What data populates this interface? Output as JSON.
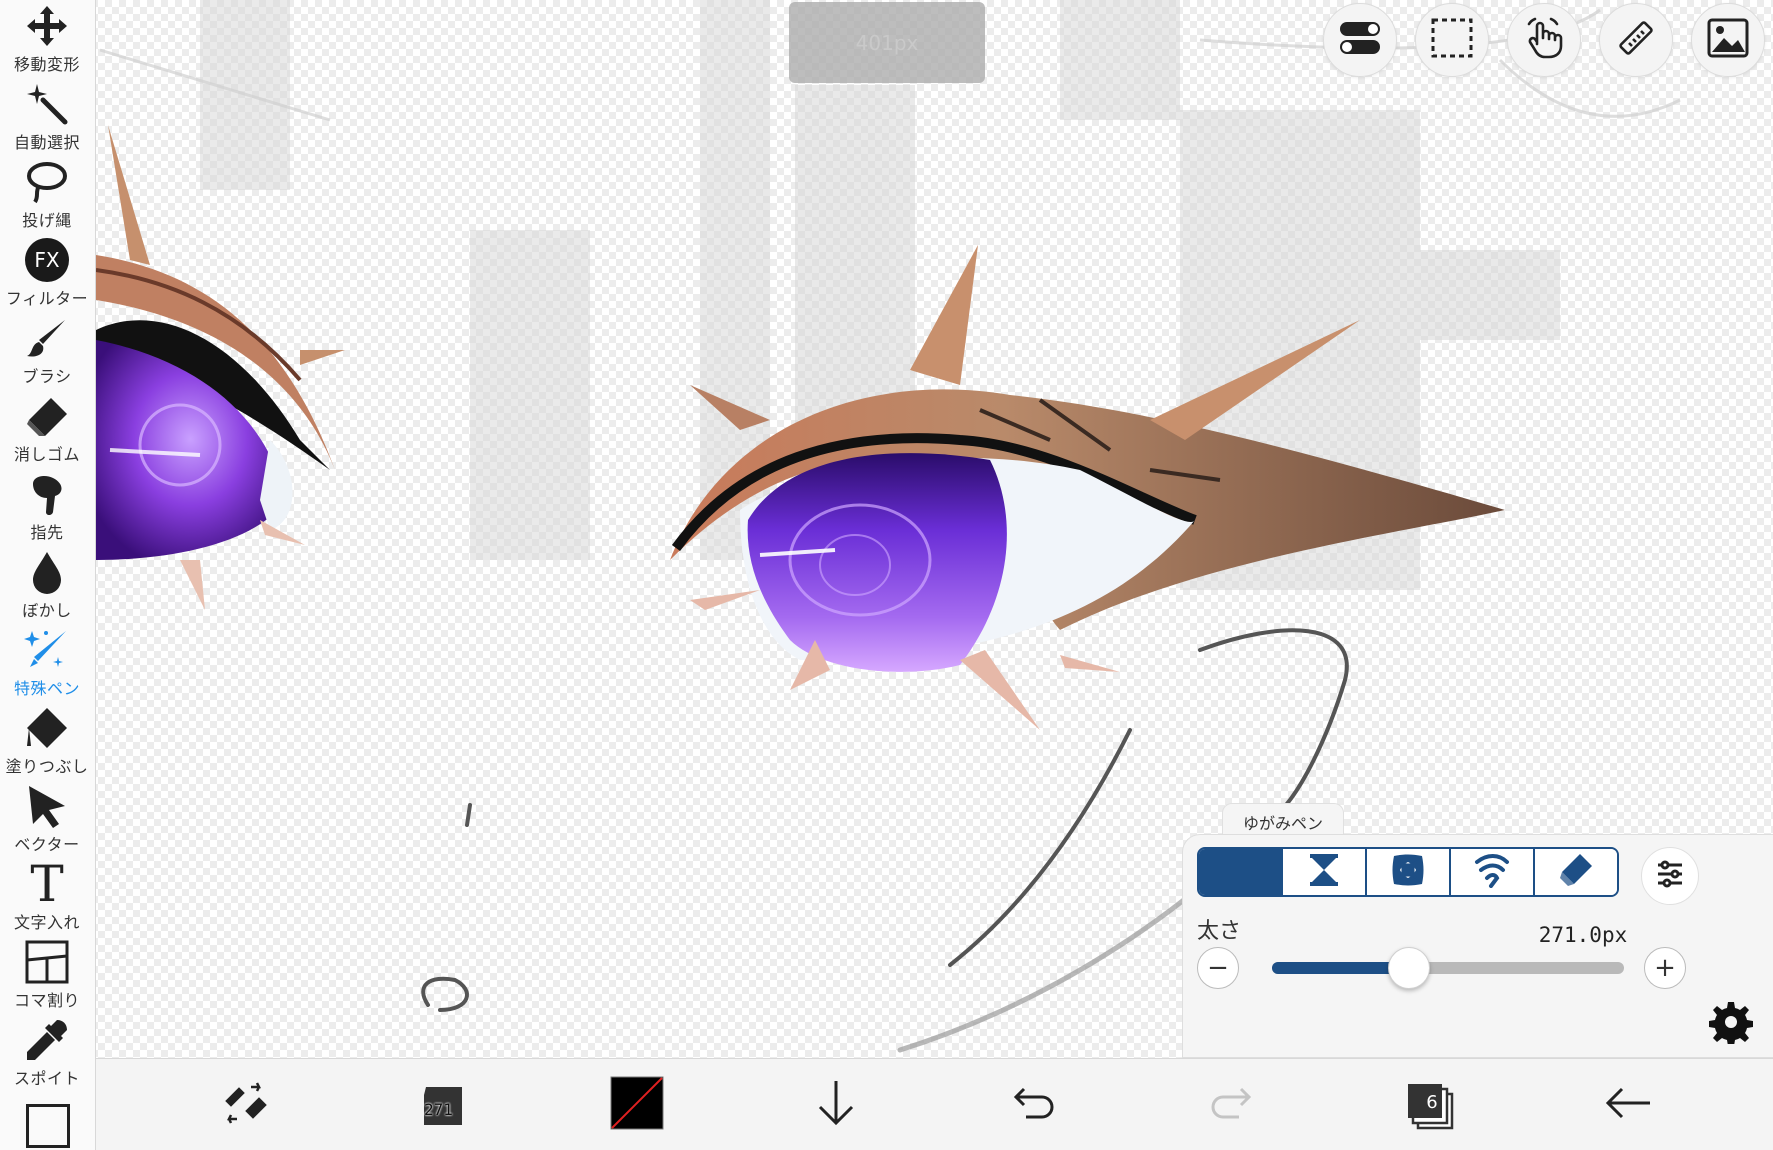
{
  "toolbar": {
    "tools": [
      {
        "label": "移動変形",
        "icon": "move-transform-icon"
      },
      {
        "label": "自動選択",
        "icon": "magic-wand-icon"
      },
      {
        "label": "投げ縄",
        "icon": "lasso-icon"
      },
      {
        "label": "フィルター",
        "icon": "fx-filter-icon"
      },
      {
        "label": "ブラシ",
        "icon": "brush-icon"
      },
      {
        "label": "消しゴム",
        "icon": "eraser-icon"
      },
      {
        "label": "指先",
        "icon": "finger-smudge-icon"
      },
      {
        "label": "ぼかし",
        "icon": "blur-drop-icon"
      },
      {
        "label": "特殊ペン",
        "icon": "special-pen-icon",
        "active": true
      },
      {
        "label": "塗りつぶし",
        "icon": "fill-bucket-icon"
      },
      {
        "label": "ベクター",
        "icon": "vector-cursor-icon"
      },
      {
        "label": "文字入れ",
        "icon": "text-icon"
      },
      {
        "label": "コマ割り",
        "icon": "frame-divider-icon"
      },
      {
        "label": "スポイト",
        "icon": "eyedropper-icon"
      }
    ],
    "fx_glyph": "FX",
    "text_glyph": "T",
    "active_color": "#1f8ee8"
  },
  "size_indicator": "401px",
  "top_buttons": [
    {
      "name": "toggle-icon"
    },
    {
      "name": "selection-rect-icon"
    },
    {
      "name": "hand-touch-icon"
    },
    {
      "name": "ruler-icon"
    },
    {
      "name": "image-material-icon"
    }
  ],
  "brush_panel": {
    "tab_label": "ゆがみペン",
    "modes": [
      {
        "icon": "crescent-push-icon",
        "active": true
      },
      {
        "icon": "hourglass-pinch-icon",
        "active": false
      },
      {
        "icon": "bloat-icon",
        "active": false
      },
      {
        "icon": "swirl-icon",
        "active": false
      },
      {
        "icon": "eraser-restore-icon",
        "active": false
      }
    ],
    "size_label": "太さ",
    "size_value": "271.0px",
    "slider_fraction": 0.39,
    "minus_glyph": "−",
    "plus_glyph": "+",
    "accent": "#1d4f86"
  },
  "bottom_bar": {
    "brush_size": "271",
    "layer_count": "6",
    "primary_color": "#000000",
    "icons": [
      "brush-adjust-icon",
      "brush-size-icon",
      "color-swatch-icon",
      "download-arrow-icon",
      "undo-icon",
      "redo-icon",
      "layers-icon",
      "back-arrow-icon"
    ]
  }
}
